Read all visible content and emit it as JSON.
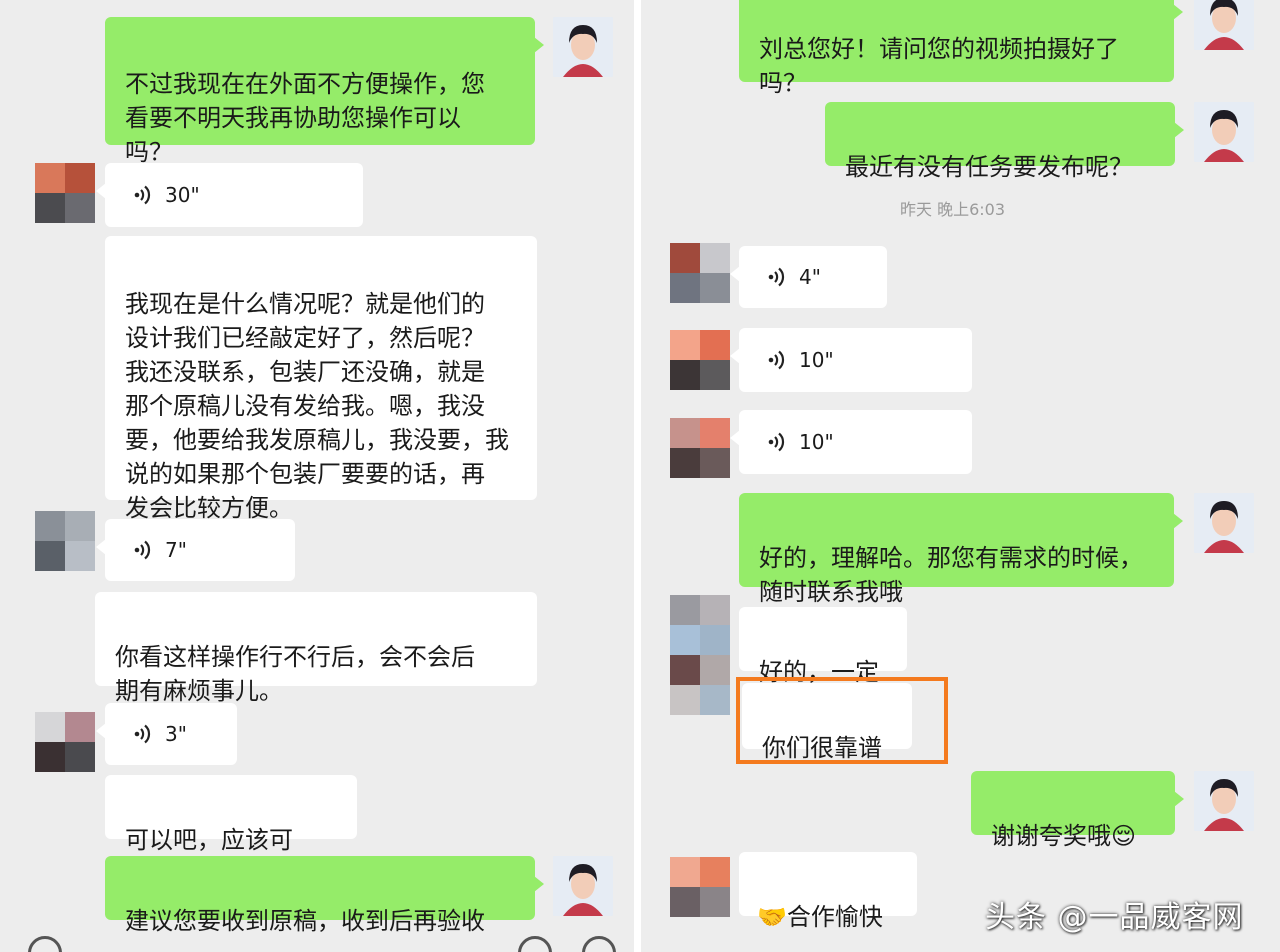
{
  "left": {
    "messages": [
      {
        "type": "sent",
        "text": "不过我现在在外面不方便操作，您\n看要不明天我再协助您操作可以\n吗？"
      },
      {
        "type": "voice",
        "duration": "30\""
      },
      {
        "type": "received",
        "text": "我现在是什么情况呢？就是他们的\n设计我们已经敲定好了，然后呢？\n我还没联系，包装厂还没确，就是\n那个原稿儿没有发给我。嗯，我没\n要，他要给我发原稿儿，我没要，我\n说的如果那个包装厂要要的话，再\n发会比较方便。"
      },
      {
        "type": "voice",
        "duration": "7\""
      },
      {
        "type": "received",
        "text": "你看这样操作行不行后，会不会后\n期有麻烦事儿。"
      },
      {
        "type": "voice",
        "duration": "3\""
      },
      {
        "type": "received",
        "text": "可以吧，应该可以。"
      },
      {
        "type": "sent",
        "text": "建议您要收到原稿，收到后再验收"
      }
    ]
  },
  "right": {
    "messages": [
      {
        "type": "sent",
        "text": "刘总您好！请问您的视频拍摄好了\n吗？"
      },
      {
        "type": "sent",
        "text": "最近有没有任务要发布呢？"
      },
      {
        "type": "timestamp",
        "text": "昨天 晚上6:03"
      },
      {
        "type": "voice",
        "duration": "4\""
      },
      {
        "type": "voice",
        "duration": "10\""
      },
      {
        "type": "voice",
        "duration": "10\""
      },
      {
        "type": "sent",
        "text": "好的，理解哈。那您有需求的时候，\n随时联系我哦"
      },
      {
        "type": "received",
        "text": "好的，一定"
      },
      {
        "type": "received",
        "text": "你们很靠谱"
      },
      {
        "type": "sent",
        "text": "谢谢夸奖哦😌"
      },
      {
        "type": "received",
        "text": "🤝合作愉快"
      }
    ]
  },
  "watermark": "头条 @一品威客网",
  "colors": {
    "sent_bubble": "#95ec69",
    "received_bubble": "#ffffff",
    "chat_background": "#ededed",
    "highlight": "#f47a1e"
  },
  "icons": [
    "voice-message-icon",
    "avatar-icon"
  ]
}
